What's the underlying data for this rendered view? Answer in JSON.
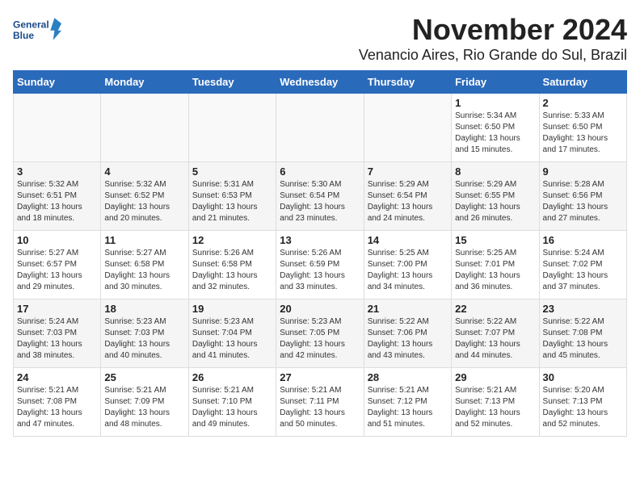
{
  "logo": {
    "line1": "General",
    "line2": "Blue"
  },
  "title": "November 2024",
  "location": "Venancio Aires, Rio Grande do Sul, Brazil",
  "weekdays": [
    "Sunday",
    "Monday",
    "Tuesday",
    "Wednesday",
    "Thursday",
    "Friday",
    "Saturday"
  ],
  "weeks": [
    [
      {
        "day": "",
        "info": ""
      },
      {
        "day": "",
        "info": ""
      },
      {
        "day": "",
        "info": ""
      },
      {
        "day": "",
        "info": ""
      },
      {
        "day": "",
        "info": ""
      },
      {
        "day": "1",
        "info": "Sunrise: 5:34 AM\nSunset: 6:50 PM\nDaylight: 13 hours and 15 minutes."
      },
      {
        "day": "2",
        "info": "Sunrise: 5:33 AM\nSunset: 6:50 PM\nDaylight: 13 hours and 17 minutes."
      }
    ],
    [
      {
        "day": "3",
        "info": "Sunrise: 5:32 AM\nSunset: 6:51 PM\nDaylight: 13 hours and 18 minutes."
      },
      {
        "day": "4",
        "info": "Sunrise: 5:32 AM\nSunset: 6:52 PM\nDaylight: 13 hours and 20 minutes."
      },
      {
        "day": "5",
        "info": "Sunrise: 5:31 AM\nSunset: 6:53 PM\nDaylight: 13 hours and 21 minutes."
      },
      {
        "day": "6",
        "info": "Sunrise: 5:30 AM\nSunset: 6:54 PM\nDaylight: 13 hours and 23 minutes."
      },
      {
        "day": "7",
        "info": "Sunrise: 5:29 AM\nSunset: 6:54 PM\nDaylight: 13 hours and 24 minutes."
      },
      {
        "day": "8",
        "info": "Sunrise: 5:29 AM\nSunset: 6:55 PM\nDaylight: 13 hours and 26 minutes."
      },
      {
        "day": "9",
        "info": "Sunrise: 5:28 AM\nSunset: 6:56 PM\nDaylight: 13 hours and 27 minutes."
      }
    ],
    [
      {
        "day": "10",
        "info": "Sunrise: 5:27 AM\nSunset: 6:57 PM\nDaylight: 13 hours and 29 minutes."
      },
      {
        "day": "11",
        "info": "Sunrise: 5:27 AM\nSunset: 6:58 PM\nDaylight: 13 hours and 30 minutes."
      },
      {
        "day": "12",
        "info": "Sunrise: 5:26 AM\nSunset: 6:58 PM\nDaylight: 13 hours and 32 minutes."
      },
      {
        "day": "13",
        "info": "Sunrise: 5:26 AM\nSunset: 6:59 PM\nDaylight: 13 hours and 33 minutes."
      },
      {
        "day": "14",
        "info": "Sunrise: 5:25 AM\nSunset: 7:00 PM\nDaylight: 13 hours and 34 minutes."
      },
      {
        "day": "15",
        "info": "Sunrise: 5:25 AM\nSunset: 7:01 PM\nDaylight: 13 hours and 36 minutes."
      },
      {
        "day": "16",
        "info": "Sunrise: 5:24 AM\nSunset: 7:02 PM\nDaylight: 13 hours and 37 minutes."
      }
    ],
    [
      {
        "day": "17",
        "info": "Sunrise: 5:24 AM\nSunset: 7:03 PM\nDaylight: 13 hours and 38 minutes."
      },
      {
        "day": "18",
        "info": "Sunrise: 5:23 AM\nSunset: 7:03 PM\nDaylight: 13 hours and 40 minutes."
      },
      {
        "day": "19",
        "info": "Sunrise: 5:23 AM\nSunset: 7:04 PM\nDaylight: 13 hours and 41 minutes."
      },
      {
        "day": "20",
        "info": "Sunrise: 5:23 AM\nSunset: 7:05 PM\nDaylight: 13 hours and 42 minutes."
      },
      {
        "day": "21",
        "info": "Sunrise: 5:22 AM\nSunset: 7:06 PM\nDaylight: 13 hours and 43 minutes."
      },
      {
        "day": "22",
        "info": "Sunrise: 5:22 AM\nSunset: 7:07 PM\nDaylight: 13 hours and 44 minutes."
      },
      {
        "day": "23",
        "info": "Sunrise: 5:22 AM\nSunset: 7:08 PM\nDaylight: 13 hours and 45 minutes."
      }
    ],
    [
      {
        "day": "24",
        "info": "Sunrise: 5:21 AM\nSunset: 7:08 PM\nDaylight: 13 hours and 47 minutes."
      },
      {
        "day": "25",
        "info": "Sunrise: 5:21 AM\nSunset: 7:09 PM\nDaylight: 13 hours and 48 minutes."
      },
      {
        "day": "26",
        "info": "Sunrise: 5:21 AM\nSunset: 7:10 PM\nDaylight: 13 hours and 49 minutes."
      },
      {
        "day": "27",
        "info": "Sunrise: 5:21 AM\nSunset: 7:11 PM\nDaylight: 13 hours and 50 minutes."
      },
      {
        "day": "28",
        "info": "Sunrise: 5:21 AM\nSunset: 7:12 PM\nDaylight: 13 hours and 51 minutes."
      },
      {
        "day": "29",
        "info": "Sunrise: 5:21 AM\nSunset: 7:13 PM\nDaylight: 13 hours and 52 minutes."
      },
      {
        "day": "30",
        "info": "Sunrise: 5:20 AM\nSunset: 7:13 PM\nDaylight: 13 hours and 52 minutes."
      }
    ]
  ]
}
